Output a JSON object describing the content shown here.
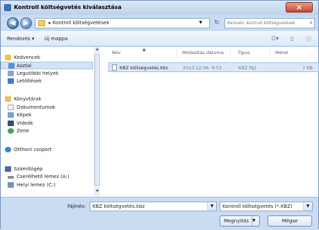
{
  "window": {
    "title": "Kontroll költségvetés kiválasztása",
    "close_label": "×"
  },
  "address": {
    "crumb": "▸ Kontroll költségvetések",
    "search_placeholder": "Keresés: Kontroll költségvetések"
  },
  "toolbar": {
    "organize_label": "Rendezés ▾",
    "new_folder_label": "Új mappa"
  },
  "sidebar": {
    "items": [
      {
        "label": "Kedvencek",
        "icon": "star-icon"
      },
      {
        "label": "Asztal",
        "icon": "desktop-icon"
      },
      {
        "label": "Legutóbbi helyek",
        "icon": "recent-places-icon"
      },
      {
        "label": "Letöltések",
        "icon": "downloads-icon"
      },
      {
        "label": "Könyvtárak",
        "icon": "libraries-icon"
      },
      {
        "label": "Dokumentumok",
        "icon": "documents-icon"
      },
      {
        "label": "Képek",
        "icon": "pictures-icon"
      },
      {
        "label": "Videók",
        "icon": "videos-icon"
      },
      {
        "label": "Zene",
        "icon": "music-icon"
      },
      {
        "label": "Otthoni csoport",
        "icon": "homegroup-icon"
      },
      {
        "label": "Számítógép",
        "icon": "computer-icon"
      },
      {
        "label": "Cserélhető lemez (A:)",
        "icon": "removable-disk-icon"
      },
      {
        "label": "Helyi lemez (C:)",
        "icon": "local-disk-icon"
      }
    ]
  },
  "list": {
    "columns": [
      "Név",
      "Módosítás dátuma",
      "Típus",
      "Méret"
    ],
    "files": [
      {
        "name": "KBZ költségvetés.kbz",
        "modified": "2013.12.06. 8:53",
        "type": "KBZ fájl",
        "size": "7 KB"
      }
    ]
  },
  "footer": {
    "filename_label": "Fájlnév:",
    "filename_value": "KBZ költségvetés.kbz",
    "filetype_value": "Kontroll költségvetés (*.KBZ)",
    "open_label": "Megnyitás",
    "cancel_label": "Mégse"
  },
  "colors": {
    "title_bar": "#c9dcf1",
    "close_button": "#c94733",
    "selection": "#dbe8f7"
  }
}
